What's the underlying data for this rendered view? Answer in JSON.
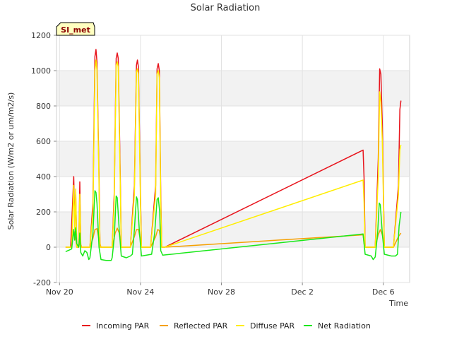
{
  "chart_data": {
    "type": "line",
    "title": "Solar Radiation",
    "xlabel": "Time",
    "ylabel": "Solar Radiation (W/m2 or um/m2/s)",
    "badge": "SI_met",
    "ylim": [
      -200,
      1200
    ],
    "yticks": [
      -200,
      0,
      200,
      400,
      600,
      800,
      1000,
      1200
    ],
    "xlim": [
      -0.15,
      17.3
    ],
    "xticks": [
      {
        "value": 0,
        "label": "Nov 20"
      },
      {
        "value": 4,
        "label": "Nov 24"
      },
      {
        "value": 8,
        "label": "Nov 28"
      },
      {
        "value": 12,
        "label": "Dec 2"
      },
      {
        "value": 16,
        "label": "Dec 6"
      }
    ],
    "grid": true,
    "legend_position": "bottom",
    "series": [
      {
        "name": "Incoming PAR",
        "color": "#e8141c",
        "points": [
          [
            0.3,
            0
          ],
          [
            0.55,
            0
          ],
          [
            0.7,
            400
          ],
          [
            0.75,
            150
          ],
          [
            0.8,
            300
          ],
          [
            0.85,
            0
          ],
          [
            0.95,
            0
          ],
          [
            1.0,
            370
          ],
          [
            1.05,
            0
          ],
          [
            1.2,
            0
          ],
          [
            1.5,
            0
          ],
          [
            1.65,
            250
          ],
          [
            1.75,
            1080
          ],
          [
            1.8,
            1120
          ],
          [
            1.85,
            1050
          ],
          [
            1.95,
            400
          ],
          [
            2.0,
            0
          ],
          [
            2.3,
            0
          ],
          [
            2.6,
            0
          ],
          [
            2.7,
            300
          ],
          [
            2.8,
            1070
          ],
          [
            2.85,
            1100
          ],
          [
            2.9,
            1070
          ],
          [
            3.0,
            400
          ],
          [
            3.05,
            0
          ],
          [
            3.5,
            0
          ],
          [
            3.7,
            350
          ],
          [
            3.8,
            1030
          ],
          [
            3.85,
            1060
          ],
          [
            3.9,
            1020
          ],
          [
            4.0,
            300
          ],
          [
            4.05,
            0
          ],
          [
            4.5,
            0
          ],
          [
            4.75,
            350
          ],
          [
            4.82,
            1010
          ],
          [
            4.88,
            1040
          ],
          [
            4.93,
            1000
          ],
          [
            5.0,
            300
          ],
          [
            5.05,
            0
          ],
          [
            5.2,
            0
          ],
          [
            15.0,
            550
          ],
          [
            15.05,
            390
          ],
          [
            15.1,
            0
          ],
          [
            15.6,
            0
          ],
          [
            15.75,
            500
          ],
          [
            15.82,
            1010
          ],
          [
            15.88,
            980
          ],
          [
            15.95,
            700
          ],
          [
            16.05,
            0
          ],
          [
            16.5,
            0
          ],
          [
            16.75,
            350
          ],
          [
            16.82,
            780
          ],
          [
            16.87,
            830
          ]
        ]
      },
      {
        "name": "Reflected PAR",
        "color": "#f5a000",
        "points": [
          [
            0.3,
            0
          ],
          [
            0.6,
            0
          ],
          [
            0.7,
            100
          ],
          [
            0.8,
            50
          ],
          [
            0.85,
            0
          ],
          [
            0.95,
            0
          ],
          [
            1.0,
            30
          ],
          [
            1.1,
            0
          ],
          [
            1.5,
            0
          ],
          [
            1.65,
            50
          ],
          [
            1.75,
            100
          ],
          [
            1.85,
            105
          ],
          [
            1.95,
            40
          ],
          [
            2.05,
            0
          ],
          [
            2.6,
            0
          ],
          [
            2.75,
            80
          ],
          [
            2.85,
            108
          ],
          [
            2.95,
            80
          ],
          [
            3.05,
            0
          ],
          [
            3.5,
            0
          ],
          [
            3.7,
            60
          ],
          [
            3.8,
            100
          ],
          [
            3.9,
            100
          ],
          [
            4.0,
            40
          ],
          [
            4.05,
            0
          ],
          [
            4.5,
            0
          ],
          [
            4.75,
            60
          ],
          [
            4.85,
            100
          ],
          [
            4.93,
            95
          ],
          [
            5.0,
            40
          ],
          [
            5.05,
            0
          ],
          [
            5.2,
            0
          ],
          [
            15.0,
            70
          ],
          [
            15.05,
            20
          ],
          [
            15.1,
            0
          ],
          [
            15.6,
            0
          ],
          [
            15.75,
            70
          ],
          [
            15.85,
            100
          ],
          [
            15.95,
            70
          ],
          [
            16.05,
            0
          ],
          [
            16.5,
            0
          ],
          [
            16.75,
            60
          ],
          [
            16.87,
            80
          ]
        ]
      },
      {
        "name": "Diffuse PAR",
        "color": "#ffee00",
        "points": [
          [
            0.3,
            0
          ],
          [
            0.6,
            0
          ],
          [
            0.7,
            350
          ],
          [
            0.75,
            100
          ],
          [
            0.8,
            330
          ],
          [
            0.85,
            0
          ],
          [
            0.95,
            0
          ],
          [
            1.0,
            300
          ],
          [
            1.05,
            0
          ],
          [
            1.2,
            0
          ],
          [
            1.5,
            0
          ],
          [
            1.65,
            200
          ],
          [
            1.75,
            1000
          ],
          [
            1.8,
            1060
          ],
          [
            1.85,
            1000
          ],
          [
            1.95,
            350
          ],
          [
            2.0,
            0
          ],
          [
            2.6,
            0
          ],
          [
            2.7,
            250
          ],
          [
            2.8,
            1030
          ],
          [
            2.85,
            1050
          ],
          [
            2.9,
            1020
          ],
          [
            3.0,
            350
          ],
          [
            3.05,
            0
          ],
          [
            3.5,
            0
          ],
          [
            3.7,
            300
          ],
          [
            3.8,
            990
          ],
          [
            3.85,
            1010
          ],
          [
            3.9,
            980
          ],
          [
            4.0,
            250
          ],
          [
            4.05,
            0
          ],
          [
            4.5,
            0
          ],
          [
            4.75,
            300
          ],
          [
            4.82,
            980
          ],
          [
            4.88,
            1000
          ],
          [
            4.93,
            960
          ],
          [
            5.0,
            250
          ],
          [
            5.05,
            0
          ],
          [
            5.2,
            0
          ],
          [
            15.0,
            380
          ],
          [
            15.05,
            250
          ],
          [
            15.1,
            0
          ],
          [
            15.6,
            0
          ],
          [
            15.75,
            400
          ],
          [
            15.82,
            880
          ],
          [
            15.88,
            820
          ],
          [
            15.95,
            600
          ],
          [
            16.05,
            0
          ],
          [
            16.5,
            0
          ],
          [
            16.75,
            300
          ],
          [
            16.82,
            550
          ],
          [
            16.87,
            580
          ]
        ]
      },
      {
        "name": "Net Radiation",
        "color": "#18e818",
        "points": [
          [
            0.3,
            -25
          ],
          [
            0.5,
            -15
          ],
          [
            0.6,
            -10
          ],
          [
            0.7,
            100
          ],
          [
            0.75,
            40
          ],
          [
            0.8,
            110
          ],
          [
            0.85,
            20
          ],
          [
            0.95,
            0
          ],
          [
            1.0,
            80
          ],
          [
            1.05,
            -30
          ],
          [
            1.15,
            -50
          ],
          [
            1.25,
            -20
          ],
          [
            1.35,
            -30
          ],
          [
            1.45,
            -70
          ],
          [
            1.5,
            -60
          ],
          [
            1.65,
            80
          ],
          [
            1.75,
            320
          ],
          [
            1.8,
            310
          ],
          [
            1.85,
            250
          ],
          [
            1.95,
            0
          ],
          [
            2.05,
            -70
          ],
          [
            2.3,
            -75
          ],
          [
            2.55,
            -75
          ],
          [
            2.6,
            -60
          ],
          [
            2.7,
            50
          ],
          [
            2.8,
            290
          ],
          [
            2.85,
            280
          ],
          [
            2.95,
            100
          ],
          [
            3.05,
            -50
          ],
          [
            3.3,
            -60
          ],
          [
            3.5,
            -50
          ],
          [
            3.6,
            -40
          ],
          [
            3.7,
            100
          ],
          [
            3.8,
            285
          ],
          [
            3.85,
            270
          ],
          [
            3.95,
            80
          ],
          [
            4.05,
            -50
          ],
          [
            4.3,
            -45
          ],
          [
            4.55,
            -40
          ],
          [
            4.7,
            80
          ],
          [
            4.82,
            270
          ],
          [
            4.88,
            280
          ],
          [
            4.95,
            200
          ],
          [
            5.0,
            -20
          ],
          [
            5.1,
            -45
          ],
          [
            15.0,
            75
          ],
          [
            15.05,
            20
          ],
          [
            15.1,
            -40
          ],
          [
            15.4,
            -50
          ],
          [
            15.5,
            -70
          ],
          [
            15.6,
            -55
          ],
          [
            15.72,
            80
          ],
          [
            15.8,
            250
          ],
          [
            15.85,
            240
          ],
          [
            15.95,
            80
          ],
          [
            16.05,
            -40
          ],
          [
            16.4,
            -50
          ],
          [
            16.6,
            -50
          ],
          [
            16.7,
            -40
          ],
          [
            16.78,
            120
          ],
          [
            16.87,
            200
          ]
        ]
      }
    ]
  }
}
